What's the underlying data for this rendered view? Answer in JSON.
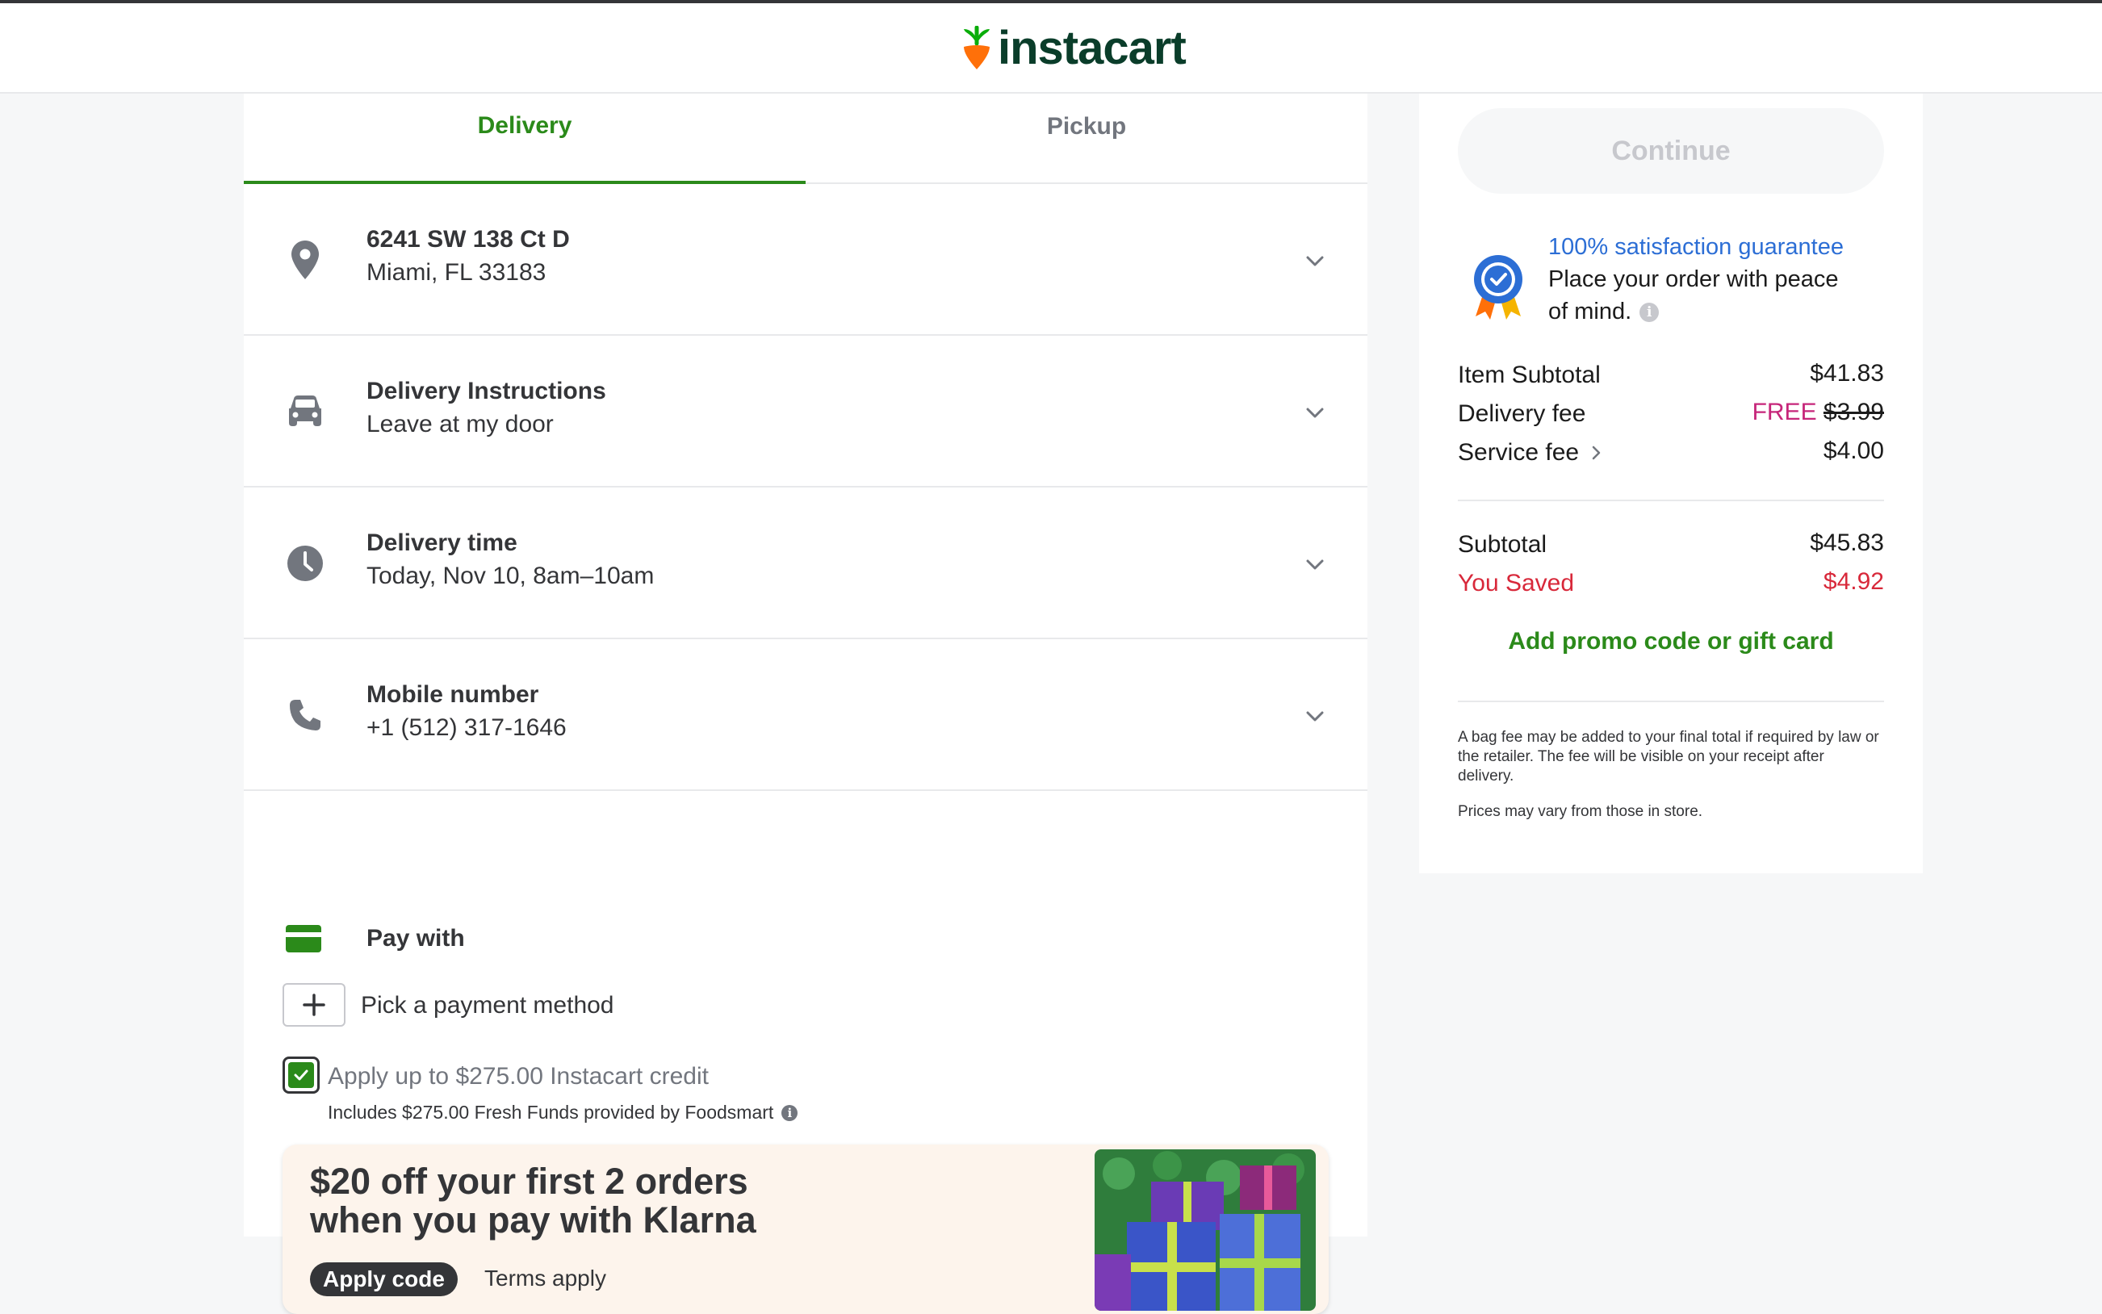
{
  "brand": {
    "name": "instacart",
    "color": "#0a3d2a",
    "accent": "#2b8a1a",
    "carrot": "#ff7009"
  },
  "tabs": [
    {
      "label": "Delivery",
      "active": true
    },
    {
      "label": "Pickup",
      "active": false
    }
  ],
  "rows": [
    {
      "icon": "location-pin-icon",
      "title": "6241 SW 138 Ct D",
      "subtitle": "Miami, FL 33183"
    },
    {
      "icon": "car-icon",
      "title": "Delivery Instructions",
      "subtitle": "Leave at my door"
    },
    {
      "icon": "clock-icon",
      "title": "Delivery time",
      "subtitle": "Today, Nov 10, 8am–10am"
    },
    {
      "icon": "phone-icon",
      "title": "Mobile number",
      "subtitle": "+1 (512) 317-1646"
    }
  ],
  "payment": {
    "title": "Pay with",
    "pick_label": "Pick a payment method",
    "credit": {
      "checked": true,
      "label": "Apply up to $275.00 Instacart credit",
      "sub": "Includes $275.00 Fresh Funds provided by Foodsmart"
    }
  },
  "promo": {
    "line1": "$20 off your first 2 orders",
    "line2": "when you pay with Klarna",
    "button": "Apply code",
    "terms": "Terms apply"
  },
  "summary": {
    "continue_label": "Continue",
    "guarantee_title": "100% satisfaction guarantee",
    "guarantee_text1": "Place your order with peace",
    "guarantee_text2": "of mind.",
    "item_subtotal_label": "Item Subtotal",
    "item_subtotal_value": "$41.83",
    "delivery_fee_label": "Delivery fee",
    "delivery_fee_free": "FREE",
    "delivery_fee_original": "$3.99",
    "service_fee_label": "Service fee",
    "service_fee_value": "$4.00",
    "subtotal_label": "Subtotal",
    "subtotal_value": "$45.83",
    "saved_label": "You Saved",
    "saved_value": "$4.92",
    "promo_link": "Add promo code or gift card",
    "fine_print_1": "A bag fee may be added to your final total if required by law or the retailer. The fee will be visible on your receipt after delivery.",
    "fine_print_2": "Prices may vary from those in store."
  }
}
